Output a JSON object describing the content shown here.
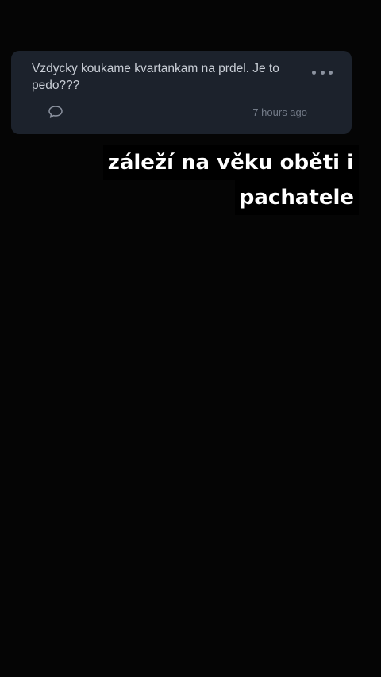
{
  "question_card": {
    "text": "Vzdycky koukame kvartankam na prdel. Je to pedo???",
    "time": "7 hours ago",
    "icons": {
      "more": "more-dots-icon",
      "comment": "comment-bubble-icon"
    },
    "colors": {
      "card_background": "#1c222c",
      "text": "#c9ced6",
      "meta": "#737b88"
    }
  },
  "caption": {
    "lines": [
      "záleží na věku oběti i",
      "pachatele"
    ],
    "colors": {
      "text": "#ffffff",
      "background": "#000000"
    }
  },
  "background_color": "#050505"
}
